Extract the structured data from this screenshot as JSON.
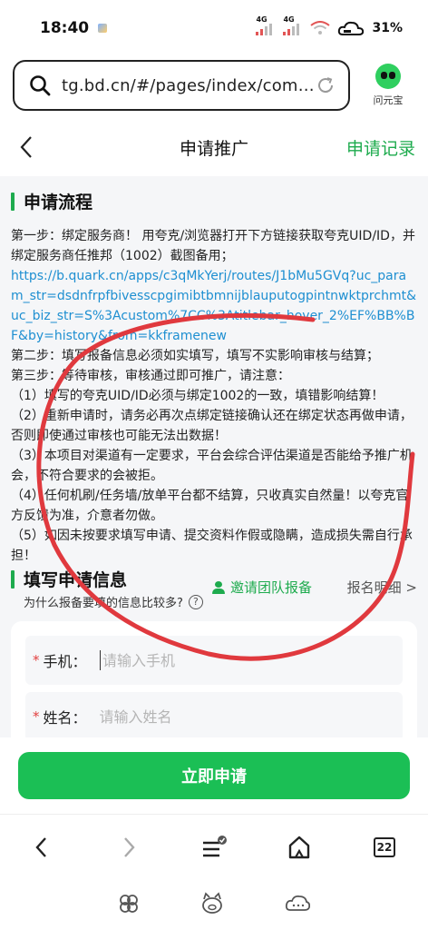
{
  "status": {
    "time": "18:40",
    "net1": "4G",
    "net2": "4G",
    "battery": "31%"
  },
  "browser": {
    "url": "tg.bd.cn/#/pages/index/comp…",
    "ai_label": "问元宝"
  },
  "header": {
    "title": "申请推广",
    "record": "申请记录"
  },
  "flow": {
    "title": "申请流程",
    "step1": "第一步：绑定服务商！ 用夸克/浏览器打开下方链接获取夸克UID/ID，并绑定服务商任推邦（1002）截图备用；",
    "link": "https://b.quark.cn/apps/c3qMkYerj/routes/J1bMu5GVq?uc_param_str=dsdnfrpfbivesscpgimibtbmnijblauputogpintnwktprchmt&uc_biz_str=S%3Acustom%7CC%3Atitlebar_hover_2%EF%BB%BF&by=history&from=kkframenew",
    "step2": "第二步：填写报备信息必须如实填写，填写不实影响审核与结算；",
    "step3": "第三步：等待审核，审核通过即可推广，请注意：",
    "note1": "（1）填写的夸克UID/ID必须与绑定1002的一致，填错影响结算！",
    "note2": "（2）重新申请时，请务必再次点绑定链接确认还在绑定状态再做申请，否则即使通过审核也可能无法出数据！",
    "note3": "（3）本项目对渠道有一定要求，平台会综合评估渠道是否能给予推广机会，不符合要求的会被拒。",
    "note4": "（4）任何机刷/任务墙/放单平台都不结算，只收真实自然量！以夸克官方反馈为准，介意者勿做。",
    "note5": "（5）如因未按要求填写申请、提交资料作假或隐瞒，造成损失需自行承担！"
  },
  "info": {
    "title": "填写申请信息",
    "subtitle": "为什么报备要填的信息比较多?",
    "invite": "邀请团队报备",
    "detail": "报名明细 >"
  },
  "form": {
    "phone_label": "手机：",
    "phone_placeholder": "请输入手机",
    "name_label": "姓名：",
    "name_placeholder": "请输入姓名"
  },
  "submit": "立即申请",
  "nav": {
    "tabs_count": "22"
  },
  "colors": {
    "accent": "#1eab4e",
    "button": "#1bbf55",
    "link": "#1e8fd1",
    "scribble": "#e0393e"
  }
}
